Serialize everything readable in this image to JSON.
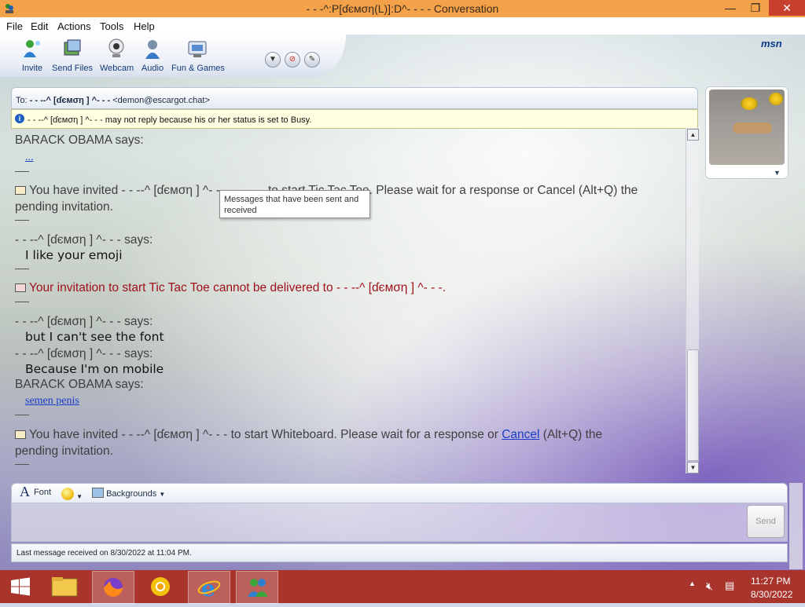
{
  "window": {
    "title": "- - -^:P[ɗємση(L)]:D^- - - - Conversation",
    "minimize_glyph": "—",
    "maximize_glyph": "❐",
    "close_glyph": "✕"
  },
  "menu": [
    "File",
    "Edit",
    "Actions",
    "Tools",
    "Help"
  ],
  "toolbar": {
    "buttons": [
      {
        "label": "Invite",
        "icon": "invite-icon"
      },
      {
        "label": "Send Files",
        "icon": "send-files-icon"
      },
      {
        "label": "Webcam",
        "icon": "webcam-icon"
      },
      {
        "label": "Audio",
        "icon": "audio-icon"
      },
      {
        "label": "Fun & Games",
        "icon": "fun-games-icon"
      }
    ],
    "brand": "msn"
  },
  "to_bar": {
    "label": "To:",
    "name": "- - --^ [ɗємση ] ^- - -",
    "email": "<demon@escargot.chat>"
  },
  "notice": {
    "icon": "i",
    "text": "- - --^ [ɗємση ] ^- - - may not reply because his or her status is set to Busy."
  },
  "conversation": {
    "messages": {
      "m1_sender": "BARACK OBAMA says:",
      "m1_text": "...",
      "inv1_a": "You have invited - - --^ [ɗємση ] ^- - -",
      "inv1_b": "to start Tic Tac Toe. Please wait for a response or Cancel (Alt+Q) the",
      "inv1_c": "pending invitation.",
      "m2_sender": "- - --^ [ɗємση ] ^- - - says:",
      "m2_text": "I like your emoji",
      "err_text": "Your invitation to start Tic Tac Toe cannot be delivered to - - --^ [ɗємση ] ^- - -.",
      "m3_sender": "- - --^ [ɗємση ] ^- - - says:",
      "m3_text": "but I can't see the font",
      "m4_sender": "- - --^ [ɗємση ] ^- - - says:",
      "m4_text": "Because I'm on mobile",
      "m5_sender": "BARACK OBAMA says:",
      "m5_text": "semen penis",
      "inv2_a": "You have invited - - --^ [ɗємση ] ^- - - to start Whiteboard. Please wait for a response or",
      "inv2_link": "Cancel",
      "inv2_b": "(Alt+Q) the",
      "inv2_c": "pending invitation."
    },
    "tooltip": "Messages that have been sent and received"
  },
  "input": {
    "font_label": "Font",
    "backgrounds_label": "Backgrounds",
    "send_label": "Send"
  },
  "status": "Last message received on 8/30/2022 at 11:04 PM.",
  "taskbar": {
    "time": "11:27 PM",
    "date": "8/30/2022",
    "apps": [
      "start-icon",
      "file-explorer-icon",
      "firefox-icon",
      "chrome-icon",
      "internet-explorer-icon",
      "msn-messenger-icon"
    ]
  }
}
